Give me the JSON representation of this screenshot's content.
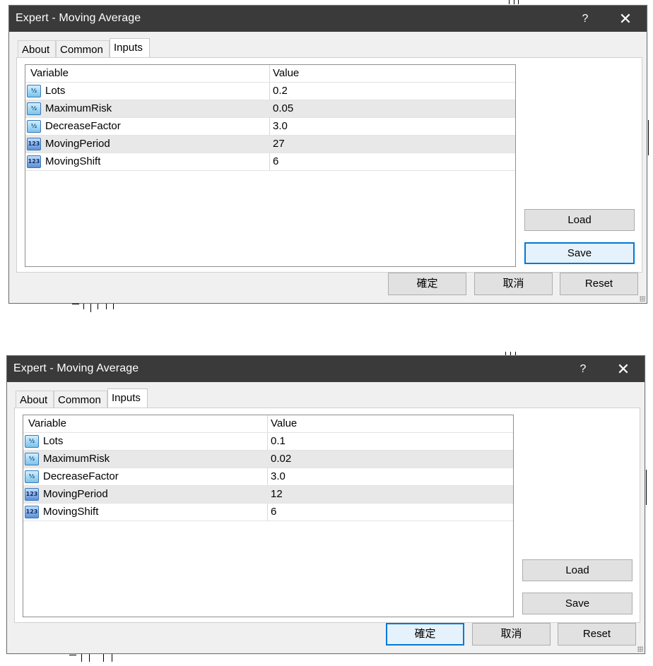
{
  "dialogs": [
    {
      "title": "Expert - Moving Average",
      "help_label": "?",
      "close_label": "✕",
      "tabs": [
        "About",
        "Common",
        "Inputs"
      ],
      "active_tab": "Inputs",
      "table": {
        "headers": [
          "Variable",
          "Value"
        ],
        "rows": [
          {
            "icon": "double-icon",
            "icon_text": "½",
            "variable": "Lots",
            "value": "0.2"
          },
          {
            "icon": "double-icon",
            "icon_text": "½",
            "variable": "MaximumRisk",
            "value": "0.05"
          },
          {
            "icon": "double-icon",
            "icon_text": "½",
            "variable": "DecreaseFactor",
            "value": "3.0"
          },
          {
            "icon": "integer-icon",
            "icon_text": "123",
            "variable": "MovingPeriod",
            "value": "27"
          },
          {
            "icon": "integer-icon",
            "icon_text": "123",
            "variable": "MovingShift",
            "value": "6"
          }
        ]
      },
      "side_buttons": {
        "load": "Load",
        "save": "Save"
      },
      "bottom_buttons": {
        "ok": "確定",
        "cancel": "取消",
        "reset": "Reset"
      },
      "focused_button": "save"
    },
    {
      "title": "Expert - Moving Average",
      "help_label": "?",
      "close_label": "✕",
      "tabs": [
        "About",
        "Common",
        "Inputs"
      ],
      "active_tab": "Inputs",
      "table": {
        "headers": [
          "Variable",
          "Value"
        ],
        "rows": [
          {
            "icon": "double-icon",
            "icon_text": "½",
            "variable": "Lots",
            "value": "0.1"
          },
          {
            "icon": "double-icon",
            "icon_text": "½",
            "variable": "MaximumRisk",
            "value": "0.02"
          },
          {
            "icon": "double-icon",
            "icon_text": "½",
            "variable": "DecreaseFactor",
            "value": "3.0"
          },
          {
            "icon": "integer-icon",
            "icon_text": "123",
            "variable": "MovingPeriod",
            "value": "12"
          },
          {
            "icon": "integer-icon",
            "icon_text": "123",
            "variable": "MovingShift",
            "value": "6"
          }
        ]
      },
      "side_buttons": {
        "load": "Load",
        "save": "Save"
      },
      "bottom_buttons": {
        "ok": "確定",
        "cancel": "取消",
        "reset": "Reset"
      },
      "focused_button": "ok"
    }
  ],
  "colors": {
    "titlebar": "#3a3a3a",
    "dialog_bg": "#f0f0f0",
    "alt_row": "#e8e8e8",
    "focus_border": "#0078d7"
  }
}
